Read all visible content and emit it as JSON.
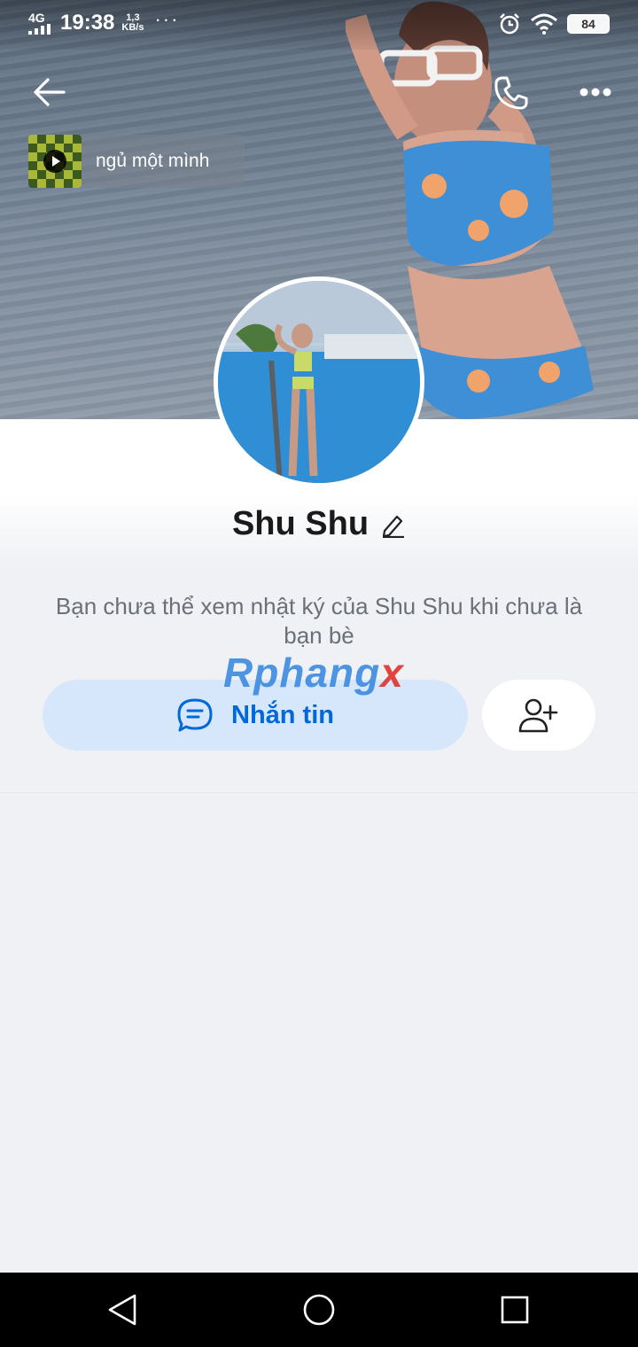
{
  "status_bar": {
    "network": "4G",
    "time": "19:38",
    "speed_value": "1,3",
    "speed_unit": "KB/s",
    "more": "···",
    "battery": "84"
  },
  "header": {
    "back_icon": "arrow-left-icon",
    "call_icon": "phone-icon",
    "more_icon": "more-dots-icon"
  },
  "music": {
    "title": "ngủ một mình",
    "play_icon": "play-icon"
  },
  "profile": {
    "name": "Shu Shu",
    "edit_icon": "pencil-icon",
    "notice": "Bạn chưa thể xem nhật ký của Shu Shu khi chưa là bạn bè"
  },
  "watermark": {
    "main": "Rphang",
    "accent": "x"
  },
  "actions": {
    "message_label": "Nhắn tin",
    "message_icon": "chat-bubble-icon",
    "add_friend_icon": "add-user-icon"
  },
  "colors": {
    "accent": "#0068d9",
    "message_button_bg": "#d7e7fb",
    "page_bg": "#eff1f5"
  }
}
